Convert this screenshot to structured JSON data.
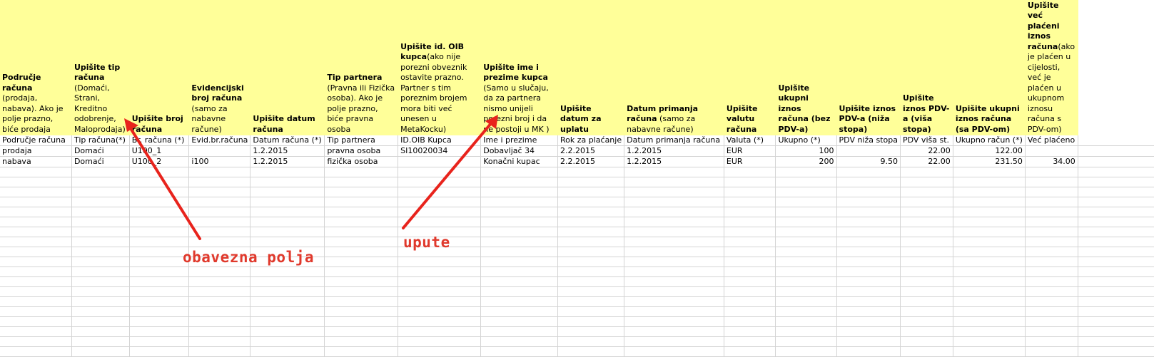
{
  "header_notes": [
    {
      "bold": "Područje računa",
      "normal": " (prodaja, nabava). Ako je polje prazno, biće prodaja"
    },
    {
      "bold": "Upišite tip računa",
      "normal": " (Domaći, Strani, Kreditno odobrenje, Maloprodaja)"
    },
    {
      "bold": "Upišite broj računa",
      "normal": ""
    },
    {
      "bold": "Evidencijski broj računa",
      "normal": " (samo za nabavne račune)"
    },
    {
      "bold": "Upišite datum računa",
      "normal": ""
    },
    {
      "bold": "Tip partnera",
      "normal": " (Pravna ili Fizička osoba). Ako je polje prazno, biće pravna osoba"
    },
    {
      "bold": "Upišite id. OIB kupca",
      "normal": "(ako nije porezni obveznik ostavite prazno. Partner s tim poreznim brojem mora biti već unesen u MetaKocku)"
    },
    {
      "bold": "Upišite ime i prezime kupca",
      "normal": " (Samo u slučaju, da za partnera nismo unijeli porezni broj i da ne postoji u MK )"
    },
    {
      "bold": "Upišite datum za uplatu",
      "normal": ""
    },
    {
      "bold": "Datum primanja računa",
      "normal": " (samo za nabavne račune)"
    },
    {
      "bold": "Upišite valutu računa",
      "normal": ""
    },
    {
      "bold": "Upišite ukupni iznos računa (bez PDV-a)",
      "normal": ""
    },
    {
      "bold": "Upišite iznos PDV-a (niža stopa)",
      "normal": ""
    },
    {
      "bold": "Upišite iznos PDV-a (viša stopa)",
      "normal": ""
    },
    {
      "bold": "Upišite ukupni iznos računa (sa PDV-om)",
      "normal": ""
    },
    {
      "bold": "Upišite već plaćeni iznos računa",
      "normal": "(ako je plaćen u cijelosti, već je plaćen u ukupnom iznosu računa s PDV-om)"
    }
  ],
  "column_labels": [
    {
      "text": "Područje računa",
      "bold": false
    },
    {
      "text": "Tip računa(*)",
      "bold": true
    },
    {
      "text": "Br. računa (*)",
      "bold": true
    },
    {
      "text": "Evid.br.računa",
      "bold": false
    },
    {
      "text": "Datum računa (*)",
      "bold": true
    },
    {
      "text": "Tip partnera",
      "bold": false
    },
    {
      "text": "ID.OIB Kupca",
      "bold": false
    },
    {
      "text": "Ime i prezime",
      "bold": false
    },
    {
      "text": "Rok za plaćanje",
      "bold": true
    },
    {
      "text": "Datum primanja računa",
      "bold": false
    },
    {
      "text": "Valuta (*)",
      "bold": true
    },
    {
      "text": "Ukupno (*)",
      "bold": true
    },
    {
      "text": "PDV niža stopa",
      "bold": false
    },
    {
      "text": "PDV viša st.",
      "bold": false
    },
    {
      "text": "Ukupno račun (*)",
      "bold": true
    },
    {
      "text": "Već plaćeno",
      "bold": false
    }
  ],
  "rows": [
    [
      "prodaja",
      "Domaći",
      "U100_1",
      "",
      "1.2.2015",
      "pravna osoba",
      "SI10020034",
      "Dobavljač 34",
      "2.2.2015",
      "1.2.2015",
      "EUR",
      "100",
      "",
      "22.00",
      "122.00",
      ""
    ],
    [
      "nabava",
      "Domaći",
      "U100_2",
      "i100",
      "1.2.2015",
      "fizička osoba",
      "",
      "Konačni kupac",
      "2.2.2015",
      "1.2.2015",
      "EUR",
      "200",
      "9.50",
      "22.00",
      "231.50",
      "34.00"
    ]
  ],
  "annotations": {
    "required_fields": "obavezna polja",
    "instructions": "upute"
  },
  "colors": {
    "header_bg": "#ffff99",
    "annotation": "#e0392c",
    "gridline": "#d4d4d4"
  }
}
